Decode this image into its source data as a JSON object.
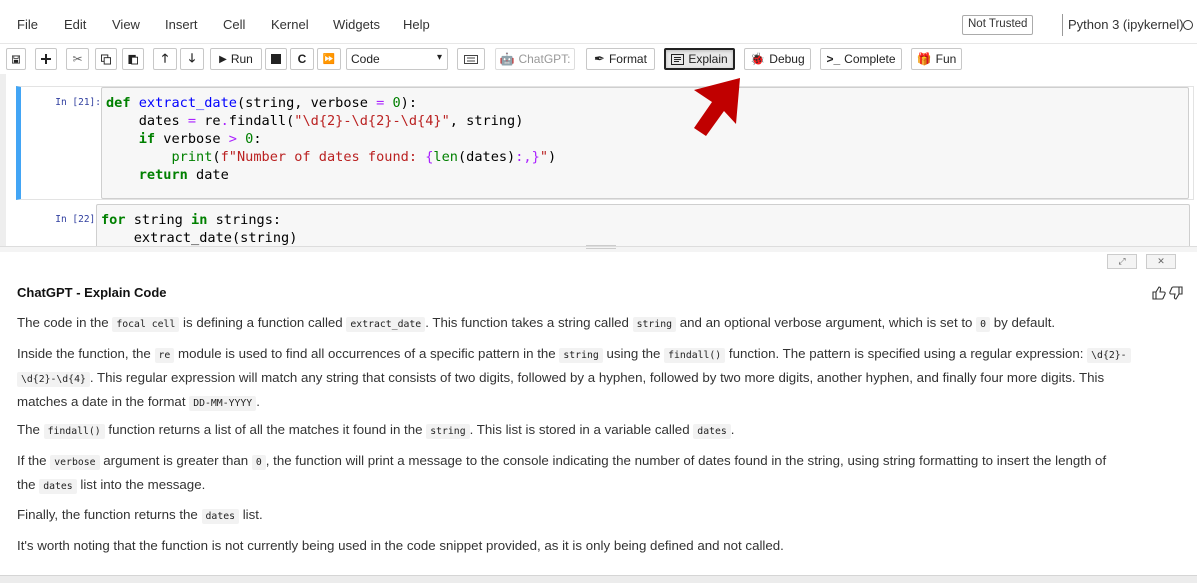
{
  "menu": [
    "File",
    "Edit",
    "View",
    "Insert",
    "Cell",
    "Kernel",
    "Widgets",
    "Help"
  ],
  "status": {
    "trust": "Not Trusted",
    "kernel": "Python 3 (ipykernel)"
  },
  "toolbar": {
    "run_label": "Run",
    "cell_type": "Code",
    "chatgpt_label": "ChatGPT:",
    "format_label": "Format",
    "explain_label": "Explain",
    "debug_label": "Debug",
    "complete_label": "Complete",
    "fun_label": "Fun"
  },
  "cells": [
    {
      "prompt": "In [21]:"
    },
    {
      "prompt": "In [22]:"
    }
  ],
  "panel": {
    "title": "ChatGPT - Explain Code",
    "p1": {
      "a": "The code in the ",
      "c1": "focal cell",
      "b": " is defining a function called ",
      "c2": "extract_date",
      "c": ". This function takes a string called ",
      "c3": "string",
      "d": " and an optional verbose argument, which is set to ",
      "c4": "0",
      "e": " by default."
    },
    "p2": {
      "a": "Inside the function, the ",
      "c1": "re",
      "b": " module is used to find all occurrences of a specific pattern in the ",
      "c2": "string",
      "c": " using the ",
      "c3": "findall()",
      "d": " function. The pattern is specified using a regular expression: ",
      "c4a": "\\d{2}-",
      "c4b": "\\d{2}-\\d{4}",
      "e": ". This regular expression will match any string that consists of two digits, followed by a hyphen, followed by two more digits, another hyphen, and finally four more digits. This",
      "f": "matches a date in the format ",
      "c5": "DD-MM-YYYY",
      "g": "."
    },
    "p3": {
      "a": "The ",
      "c1": "findall()",
      "b": " function returns a list of all the matches it found in the ",
      "c2": "string",
      "c": ". This list is stored in a variable called ",
      "c3": "dates",
      "d": "."
    },
    "p4": {
      "a": "If the ",
      "c1": "verbose",
      "b": " argument is greater than ",
      "c2": "0",
      "c": ", the function will print a message to the console indicating the number of dates found in the string, using string formatting to insert the length of",
      "d": "the ",
      "c3": "dates",
      "e": " list into the message."
    },
    "p5": {
      "a": "Finally, the function returns the ",
      "c1": "dates",
      "b": " list."
    },
    "p6": "It's worth noting that the function is not currently being used in the code snippet provided, as it is only being defined and not called."
  },
  "colors": {
    "arrow": "#c00000",
    "selected_cell": "#42a5f5"
  }
}
